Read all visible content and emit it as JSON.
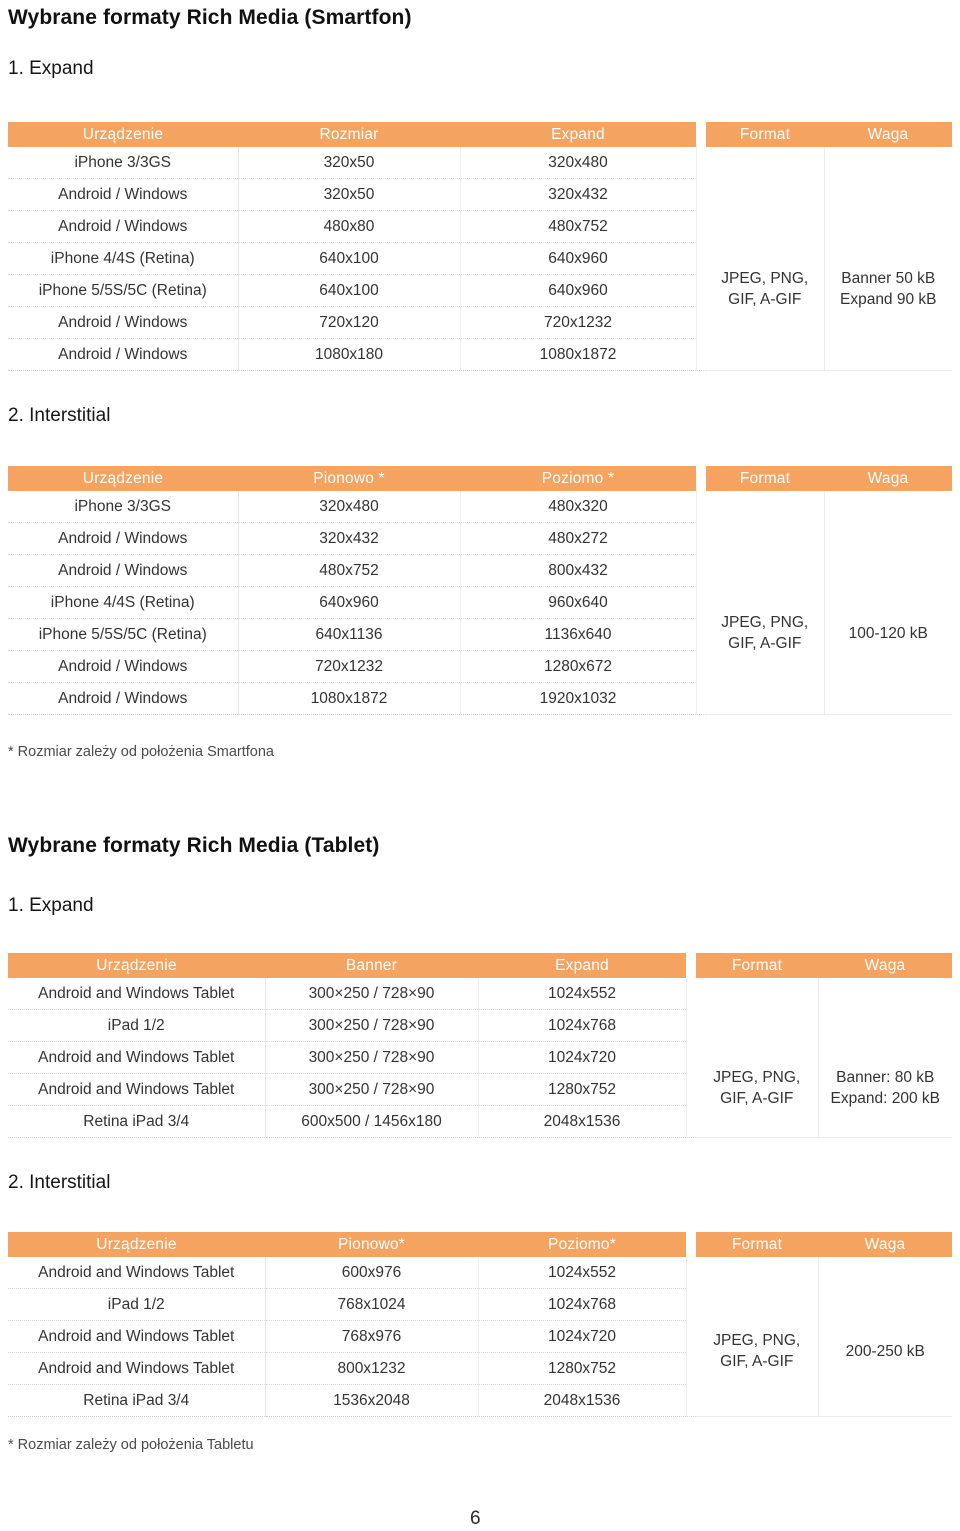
{
  "document": {
    "page_number": "6",
    "sections": [
      {
        "id": "smartphone",
        "title": "Wybrane formaty Rich Media (Smartfon)",
        "subsections": [
          {
            "id": "smartphone-expand",
            "label": "1. Expand"
          },
          {
            "id": "smartphone-interstitial",
            "label": "2. Interstitial"
          }
        ],
        "footnote": "* Rozmiar zależy od położenia Smartfona"
      },
      {
        "id": "tablet",
        "title": "Wybrane formaty Rich Media (Tablet)",
        "subsections": [
          {
            "id": "tablet-expand",
            "label": "1. Expand"
          },
          {
            "id": "tablet-interstitial",
            "label": "2. Interstitial"
          }
        ],
        "footnote": "* Rozmiar zależy od położenia Tabletu"
      }
    ]
  },
  "colors": {
    "header_orange": "#f4a460",
    "header_text": "#ffffff",
    "body_text": "#333333",
    "footnote_text": "#4a4a4a",
    "row_divider": "#d8d8d8"
  },
  "tables": {
    "smartphone_expand": {
      "headers": [
        "Urządzenie",
        "Rozmiar",
        "Expand",
        "Format",
        "Waga"
      ],
      "rows": [
        [
          "iPhone 3/3GS",
          "320x50",
          "320x480"
        ],
        [
          "Android / Windows",
          "320x50",
          "320x432"
        ],
        [
          "Android / Windows",
          "480x80",
          "480x752"
        ],
        [
          "iPhone 4/4S (Retina)",
          "640x100",
          "640x960"
        ],
        [
          "iPhone 5/5S/5C (Retina)",
          "640x100",
          "640x960"
        ],
        [
          "Android / Windows",
          "720x120",
          "720x1232"
        ],
        [
          "Android / Windows",
          "1080x180",
          "1080x1872"
        ]
      ],
      "format": [
        "JPEG, PNG,",
        "GIF, A-GIF"
      ],
      "waga": [
        "Banner 50 kB",
        "Expand 90 kB"
      ]
    },
    "smartphone_interstitial": {
      "headers": [
        "Urządzenie",
        "Pionowo *",
        "Poziomo *",
        "Format",
        "Waga"
      ],
      "rows": [
        [
          "iPhone 3/3GS",
          "320x480",
          "480x320"
        ],
        [
          "Android / Windows",
          "320x432",
          "480x272"
        ],
        [
          "Android / Windows",
          "480x752",
          "800x432"
        ],
        [
          "iPhone 4/4S (Retina)",
          "640x960",
          "960x640"
        ],
        [
          "iPhone 5/5S/5C (Retina)",
          "640x1136",
          "1136x640"
        ],
        [
          "Android / Windows",
          "720x1232",
          "1280x672"
        ],
        [
          "Android / Windows",
          "1080x1872",
          "1920x1032"
        ]
      ],
      "format": [
        "JPEG, PNG,",
        "GIF, A-GIF"
      ],
      "waga": [
        "100-120 kB"
      ]
    },
    "tablet_expand": {
      "headers": [
        "Urządzenie",
        "Banner",
        "Expand",
        "Format",
        "Waga"
      ],
      "rows": [
        [
          "Android and Windows Tablet",
          "300×250 / 728×90",
          "1024x552"
        ],
        [
          "iPad 1/2",
          "300×250 / 728×90",
          "1024x768"
        ],
        [
          "Android and Windows Tablet",
          "300×250 / 728×90",
          "1024x720"
        ],
        [
          "Android and Windows Tablet",
          "300×250 / 728×90",
          "1280x752"
        ],
        [
          "Retina iPad 3/4",
          "600x500 / 1456x180",
          "2048x1536"
        ]
      ],
      "format": [
        "JPEG, PNG,",
        "GIF, A-GIF"
      ],
      "waga": [
        "Banner: 80 kB",
        "Expand: 200 kB"
      ]
    },
    "tablet_interstitial": {
      "headers": [
        "Urządzenie",
        "Pionowo*",
        "Poziomo*",
        "Format",
        "Waga"
      ],
      "rows": [
        [
          "Android and Windows Tablet",
          "600x976",
          "1024x552"
        ],
        [
          "iPad 1/2",
          "768x1024",
          "1024x768"
        ],
        [
          "Android and Windows Tablet",
          "768x976",
          "1024x720"
        ],
        [
          "Android and Windows Tablet",
          "800x1232",
          "1280x752"
        ],
        [
          "Retina iPad 3/4",
          "1536x2048",
          "2048x1536"
        ]
      ],
      "format": [
        "JPEG, PNG,",
        "GIF, A-GIF"
      ],
      "waga": [
        "200-250 kB"
      ]
    }
  }
}
